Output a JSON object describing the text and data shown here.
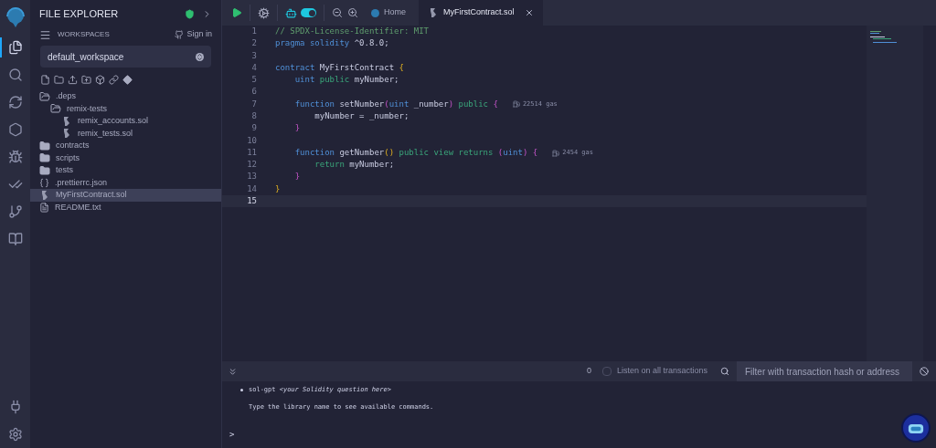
{
  "rail": {
    "top": [
      {
        "selected": true
      },
      {
        "selected": false
      },
      {
        "selected": false
      },
      {
        "selected": false
      },
      {
        "selected": false
      },
      {
        "selected": false
      },
      {
        "selected": false
      },
      {
        "selected": false
      }
    ],
    "bottom": [
      {
        "selected": false
      },
      {
        "selected": false
      }
    ]
  },
  "explorer": {
    "title": "FILE EXPLORER",
    "workspaces_label": "WORKSPACES",
    "sign_in": "Sign in",
    "workspace": "default_workspace",
    "tree": [
      {
        "name": ".deps",
        "kind": "folder",
        "expanded": true,
        "selected": false,
        "children": [
          {
            "name": "remix-tests",
            "kind": "folder",
            "expanded": true,
            "selected": false,
            "children": [
              {
                "name": "remix_accounts.sol",
                "kind": "sol",
                "selected": false
              },
              {
                "name": "remix_tests.sol",
                "kind": "sol",
                "selected": false
              }
            ]
          }
        ]
      },
      {
        "name": "contracts",
        "kind": "folder",
        "expanded": false,
        "selected": false
      },
      {
        "name": "scripts",
        "kind": "folder",
        "expanded": false,
        "selected": false
      },
      {
        "name": "tests",
        "kind": "folder",
        "expanded": false,
        "selected": false
      },
      {
        "name": ".prettierrc.json",
        "kind": "json",
        "selected": false
      },
      {
        "name": "MyFirstContract.sol",
        "kind": "sol",
        "selected": true
      },
      {
        "name": "README.txt",
        "kind": "txt",
        "selected": false
      }
    ]
  },
  "toolbar": {
    "autocompile_on": true
  },
  "tabs": [
    {
      "label": "Home",
      "kind": "home",
      "selected": false
    },
    {
      "label": "MyFirstContract.sol",
      "kind": "sol",
      "selected": true
    }
  ],
  "editor": {
    "lines": [
      {
        "number": "1",
        "current": false,
        "tokens": [
          {
            "t": "// SPDX-License-Identifier: MIT",
            "kind": "comment"
          }
        ]
      },
      {
        "number": "2",
        "current": false,
        "tokens": [
          {
            "t": "pragma solidity",
            "kind": "keyword"
          },
          {
            "t": " ^0.8.0;",
            "kind": "plain"
          }
        ]
      },
      {
        "number": "3",
        "current": false
      },
      {
        "number": "4",
        "current": false,
        "tokens": [
          {
            "t": "contract",
            "kind": "keyword"
          },
          {
            "t": " MyFirstContract ",
            "kind": "plain"
          },
          {
            "t": "{",
            "kind": "brace"
          }
        ]
      },
      {
        "number": "5",
        "current": false,
        "tokens": [
          {
            "t": "    uint",
            "kind": "keyword"
          },
          {
            "t": " public",
            "kind": "modifier"
          },
          {
            "t": " myNumber;",
            "kind": "plain"
          }
        ]
      },
      {
        "number": "6",
        "current": false
      },
      {
        "number": "7",
        "current": false,
        "tokens": [
          {
            "t": "    function",
            "kind": "keyword"
          },
          {
            "t": " setNumber",
            "kind": "plain"
          },
          {
            "t": "(",
            "kind": "paren"
          },
          {
            "t": "uint",
            "kind": "keyword"
          },
          {
            "t": " _number",
            "kind": "plain"
          },
          {
            "t": ")",
            "kind": "paren"
          },
          {
            "t": " public",
            "kind": "modifier"
          },
          {
            "t": " {",
            "kind": "paren"
          }
        ],
        "gas": "22514 gas"
      },
      {
        "number": "8",
        "current": false,
        "tokens": [
          {
            "t": "        myNumber = _number;",
            "kind": "plain"
          }
        ]
      },
      {
        "number": "9",
        "current": false,
        "tokens": [
          {
            "t": "    }",
            "kind": "paren"
          }
        ]
      },
      {
        "number": "10",
        "current": false
      },
      {
        "number": "11",
        "current": false,
        "tokens": [
          {
            "t": "    function",
            "kind": "keyword"
          },
          {
            "t": " getNumber",
            "kind": "plain"
          },
          {
            "t": "()",
            "kind": "brace"
          },
          {
            "t": " public view returns",
            "kind": "modifier"
          },
          {
            "t": " (",
            "kind": "paren"
          },
          {
            "t": "uint",
            "kind": "keyword"
          },
          {
            "t": ")",
            "kind": "paren"
          },
          {
            "t": " {",
            "kind": "paren"
          }
        ],
        "gas": "2454 gas"
      },
      {
        "number": "12",
        "current": false,
        "tokens": [
          {
            "t": "        return",
            "kind": "modifier"
          },
          {
            "t": " myNumber;",
            "kind": "plain"
          }
        ]
      },
      {
        "number": "13",
        "current": false,
        "tokens": [
          {
            "t": "    }",
            "kind": "paren"
          }
        ]
      },
      {
        "number": "14",
        "current": false,
        "tokens": [
          {
            "t": "}",
            "kind": "brace"
          }
        ]
      },
      {
        "number": "15",
        "current": true
      }
    ]
  },
  "terminal": {
    "count": "0",
    "listen": {
      "label": "Listen on all transactions",
      "checked": false
    },
    "filter_placeholder": "Filter with transaction hash or address",
    "lines": [
      {
        "kind": "bullet",
        "text": "sol-gpt *<your Solidity question here>*"
      },
      {
        "kind": "plain",
        "text": "Type the library name to see available commands."
      }
    ],
    "prompt": ">"
  }
}
